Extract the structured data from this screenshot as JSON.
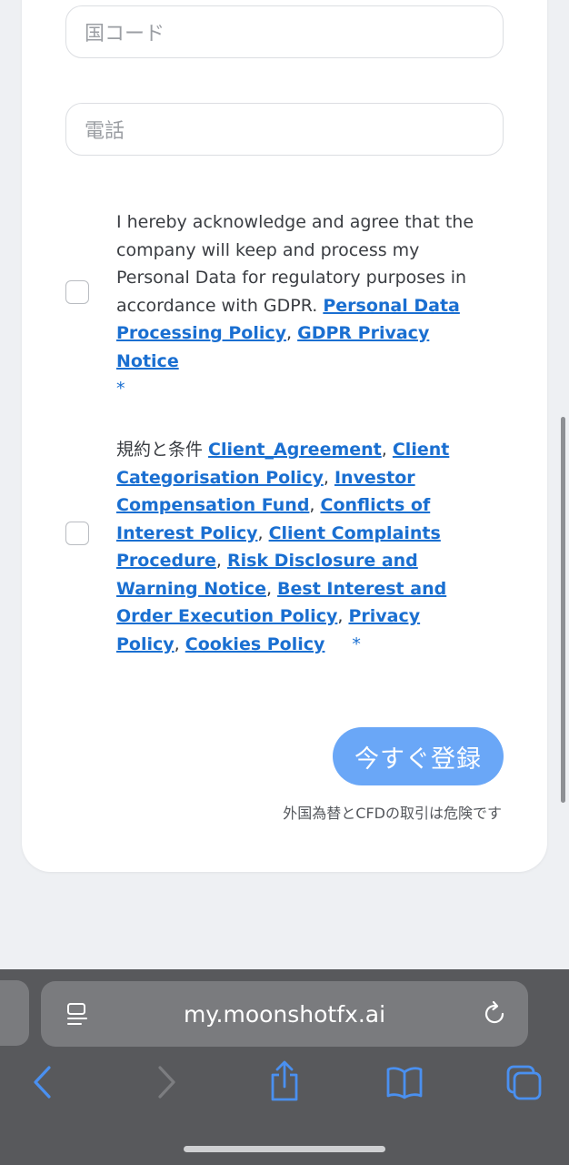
{
  "form": {
    "country_code_placeholder": "国コード",
    "phone_placeholder": "電話",
    "gdpr_consent": {
      "text": "I hereby acknowledge and agree that the company will keep and process my Personal Data for regulatory purposes in accordance with GDPR. ",
      "links": [
        "Personal Data Processing Policy",
        "GDPR Privacy Notice"
      ],
      "separator": ", ",
      "required_mark": "*"
    },
    "terms_consent": {
      "prefix": "規約と条件 ",
      "links": [
        "Client_Agreement",
        "Client Categorisation Policy",
        "Investor Compensation Fund",
        "Conflicts of Interest Policy",
        "Client Complaints Procedure",
        "Risk Disclosure and Warning Notice",
        "Best Interest and Order Execution Policy",
        "Privacy Policy",
        "Cookies Policy"
      ],
      "separator": ", ",
      "required_mark": "*"
    },
    "register_button": "今すぐ登録",
    "risk_warning": "外国為替とCFDの取引は危険です"
  },
  "browser": {
    "url": "my.moonshotfx.ai",
    "icons": [
      "reader-icon",
      "reload-icon",
      "back-icon",
      "forward-icon",
      "share-icon",
      "bookmarks-icon",
      "tabs-icon"
    ]
  },
  "colors": {
    "link": "#1a6fd1",
    "button": "#6aa7f7",
    "browser_bar": "#58595c",
    "icon_blue": "#4a90f0"
  }
}
